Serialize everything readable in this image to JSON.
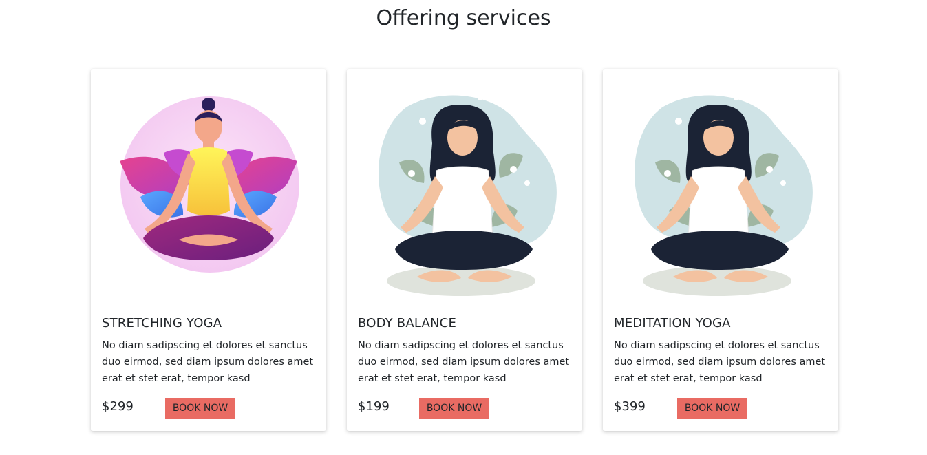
{
  "page": {
    "title": "Offering services"
  },
  "services": [
    {
      "title": "STRETCHING YOGA",
      "description": "No diam sadipscing et dolores et sanctus duo eirmod, sed diam ipsum dolores amet erat et stet erat, tempor kasd",
      "price": "$299",
      "button_label": "BOOK NOW",
      "illustration": "yoga-pose-illustration"
    },
    {
      "title": "BODY BALANCE",
      "description": "No diam sadipscing et dolores et sanctus duo eirmod, sed diam ipsum dolores amet erat et stet erat, tempor kasd",
      "price": "$199",
      "button_label": "BOOK NOW",
      "illustration": "meditation-illustration"
    },
    {
      "title": "MEDITATION YOGA",
      "description": "No diam sadipscing et dolores et sanctus duo eirmod, sed diam ipsum dolores amet erat et stet erat, tempor kasd",
      "price": "$399",
      "button_label": "BOOK NOW",
      "illustration": "meditation-illustration"
    }
  ],
  "colors": {
    "button_background": "#e96b63",
    "text": "#212529",
    "background": "#ffffff"
  }
}
